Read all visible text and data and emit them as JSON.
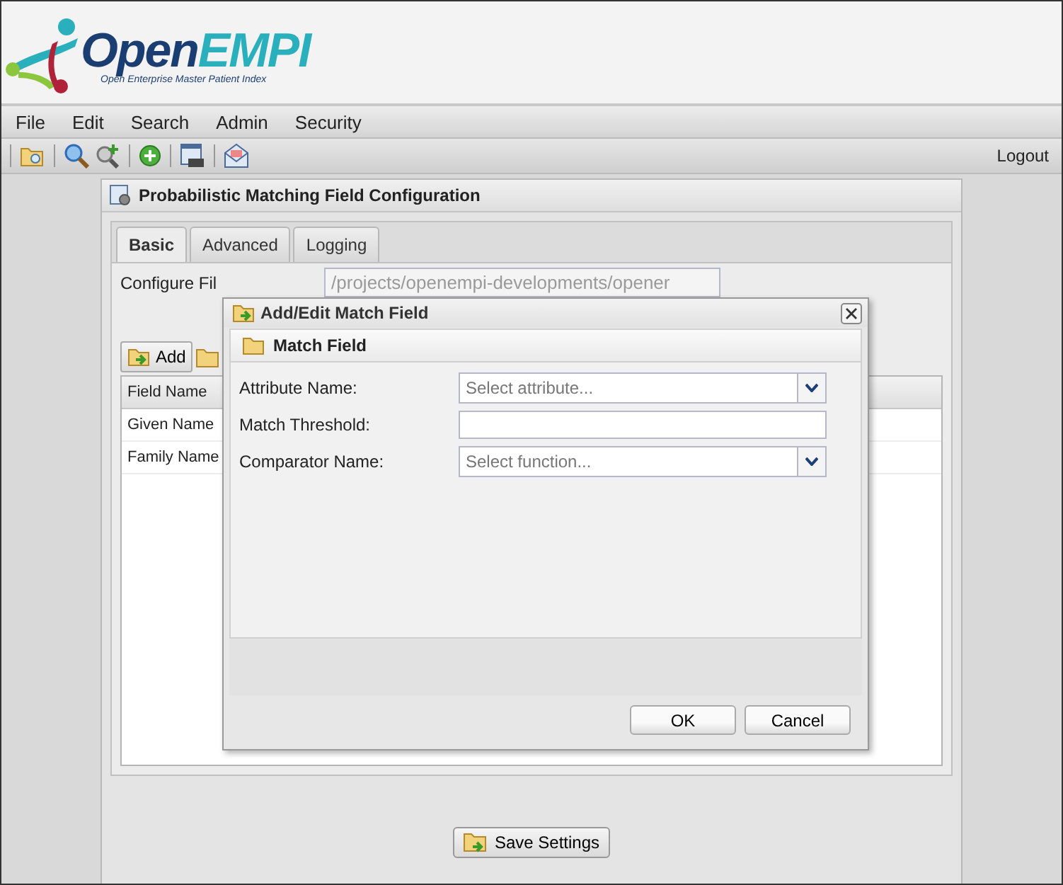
{
  "logo": {
    "name_parts": [
      "Open",
      "EMPI"
    ],
    "tagline": "Open Enterprise Master Patient Index"
  },
  "menu": [
    "File",
    "Edit",
    "Search",
    "Admin",
    "Security"
  ],
  "toolbar": {
    "logout": "Logout"
  },
  "panel": {
    "title": "Probabilistic Matching Field Configuration",
    "tabs": [
      {
        "label": "Basic",
        "selected": true
      },
      {
        "label": "Advanced",
        "selected": false
      },
      {
        "label": "Logging",
        "selected": false
      }
    ],
    "config_label": "Configure Fil",
    "config_value": "/projects/openempi-developments/opener",
    "add_button": "Add",
    "grid": {
      "column": "Field Name",
      "rows": [
        "Given Name",
        "Family Name"
      ]
    },
    "save_button": "Save Settings"
  },
  "dialog": {
    "title": "Add/Edit Match Field",
    "section": "Match Field",
    "fields": [
      {
        "kind": "combo",
        "label": "Attribute Name:",
        "placeholder": "Select attribute..."
      },
      {
        "kind": "text",
        "label": "Match Threshold:"
      },
      {
        "kind": "combo",
        "label": "Comparator Name:",
        "placeholder": "Select function..."
      }
    ],
    "buttons": [
      "OK",
      "Cancel"
    ]
  }
}
